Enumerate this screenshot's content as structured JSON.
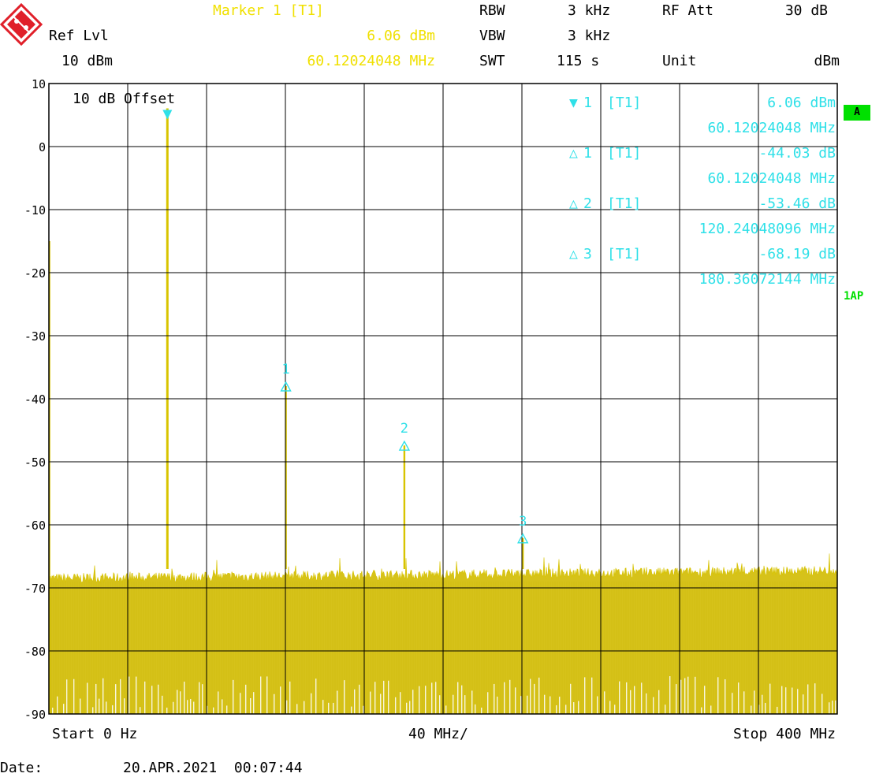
{
  "header": {
    "marker_title": "Marker 1 [T1]",
    "ref_lvl_label": "Ref Lvl",
    "ref_lvl_value": "10 dBm",
    "marker_level": "6.06 dBm",
    "marker_freq": "60.12024048 MHz",
    "rbw_label": "RBW",
    "rbw_value": "3 kHz",
    "vbw_label": "VBW",
    "vbw_value": "3 kHz",
    "swt_label": "SWT",
    "swt_value": "115 s",
    "rf_att_label": "RF Att",
    "rf_att_value": "30 dB",
    "unit_label": "Unit",
    "unit_value": "dBm"
  },
  "offset_label": "10 dB Offset",
  "side": {
    "trace_badge": "A",
    "detector": "1AP"
  },
  "marker_table": [
    {
      "symbol": "▼",
      "id": "1",
      "trace": "[T1]",
      "value": "6.06 dBm",
      "freq": "60.12024048 MHz"
    },
    {
      "symbol": "△",
      "id": "1",
      "trace": "[T1]",
      "value": "-44.03 dB",
      "freq": "60.12024048 MHz"
    },
    {
      "symbol": "△",
      "id": "2",
      "trace": "[T1]",
      "value": "-53.46 dB",
      "freq": "120.24048096 MHz"
    },
    {
      "symbol": "△",
      "id": "3",
      "trace": "[T1]",
      "value": "-68.19 dB",
      "freq": "180.36072144 MHz"
    }
  ],
  "footer": {
    "start": "Start 0 Hz",
    "div": "40 MHz/",
    "stop": "Stop 400 MHz",
    "date_label": "Date:",
    "date_value": "20.APR.2021  00:07:44"
  },
  "colors": {
    "trace": "#d8c400",
    "trace_fill": "#d6c21a",
    "marker": "#2fe0e8",
    "badge": "#00e000"
  },
  "chart_data": {
    "type": "line",
    "xlim": [
      0,
      400
    ],
    "ylim": [
      -90,
      10
    ],
    "x_unit": "MHz",
    "y_unit": "dBm",
    "grid": true,
    "yticks": [
      10,
      0,
      -10,
      -20,
      -30,
      -40,
      -50,
      -60,
      -70,
      -80,
      -90
    ],
    "noise_floor_approx": -67,
    "peaks": [
      {
        "x": 60.12,
        "y": 6.06,
        "marker": "main"
      },
      {
        "x": 120.24,
        "y": -38,
        "marker": "1"
      },
      {
        "x": 180.36,
        "y": -47.4,
        "marker": "2"
      },
      {
        "x": 240.48,
        "y": -62.1,
        "marker": "3"
      }
    ],
    "markers": [
      {
        "label": "",
        "x": 60.12,
        "y": 6.06,
        "symbol": "filled"
      },
      {
        "label": "1",
        "x": 120.24,
        "y": -38,
        "symbol": "delta"
      },
      {
        "label": "2",
        "x": 180.36,
        "y": -47.4,
        "symbol": "delta"
      },
      {
        "label": "3",
        "x": 240.48,
        "y": -62.1,
        "symbol": "delta"
      }
    ]
  }
}
